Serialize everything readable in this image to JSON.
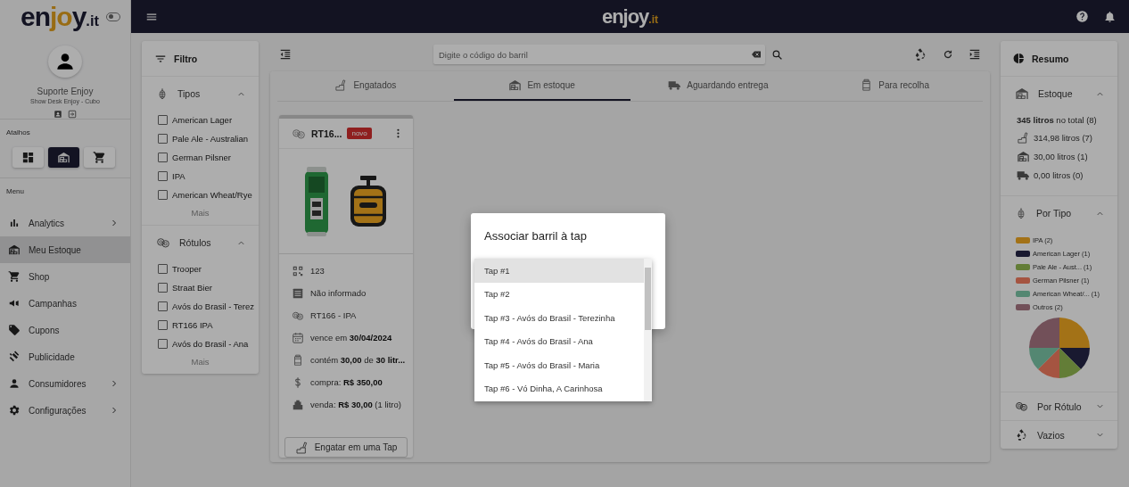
{
  "sidebar": {
    "logo": {
      "text": "enjoy",
      "suffix": ".it"
    },
    "theme_toggle": {
      "on": false
    },
    "user": {
      "name": "Suporte Enjoy",
      "subtitle": "Show Desk Enjoy - Cubo"
    },
    "shortcuts_label": "Atalhos",
    "shortcuts": [
      {
        "selected": false
      },
      {
        "selected": true
      },
      {
        "selected": false
      }
    ],
    "menu_label": "Menu",
    "menu": [
      {
        "label": "Analytics",
        "expandable": true,
        "selected": false
      },
      {
        "label": "Meu Estoque",
        "expandable": false,
        "selected": true
      },
      {
        "label": "Shop",
        "expandable": false,
        "selected": false
      },
      {
        "label": "Campanhas",
        "expandable": false,
        "selected": false
      },
      {
        "label": "Cupons",
        "expandable": false,
        "selected": false
      },
      {
        "label": "Publicidade",
        "expandable": false,
        "selected": false
      },
      {
        "label": "Consumidores",
        "expandable": true,
        "selected": false
      },
      {
        "label": "Configurações",
        "expandable": true,
        "selected": false
      }
    ]
  },
  "top_bar": {
    "logo": {
      "text": "enjoy",
      "suffix": ".it"
    }
  },
  "filter": {
    "title": "Filtro",
    "sections": [
      {
        "title": "Tipos",
        "expanded": true,
        "options": [
          {
            "label": "American Lager",
            "checked": false
          },
          {
            "label": "Pale Ale - Australian",
            "checked": false
          },
          {
            "label": "German Pilsner",
            "checked": false
          },
          {
            "label": "IPA",
            "checked": false
          },
          {
            "label": "American Wheat/Rye",
            "checked": false
          }
        ],
        "more": "Mais"
      },
      {
        "title": "Rótulos",
        "expanded": true,
        "options": [
          {
            "label": "Trooper",
            "checked": false
          },
          {
            "label": "Straat Bier",
            "checked": false
          },
          {
            "label": "Avós do Brasil - Terez",
            "checked": false
          },
          {
            "label": "RT166 IPA",
            "checked": false
          },
          {
            "label": "Avós do Brasil - Ana",
            "checked": false
          }
        ],
        "more": "Mais"
      }
    ]
  },
  "search": {
    "placeholder": "Digite o código do barril"
  },
  "tabs": [
    {
      "label": "Engatados",
      "selected": false
    },
    {
      "label": "Em estoque",
      "selected": true
    },
    {
      "label": "Aguardando entrega",
      "selected": false
    },
    {
      "label": "Para recolha",
      "selected": false
    }
  ],
  "card": {
    "title": "RT16...",
    "badge": "novo",
    "details": [
      "123",
      "Não informado",
      "RT166 - IPA",
      "vence em **30/04/2024**",
      "contém **30,00** de **30 litr...**",
      "compra: **R$ 350,00**",
      "venda: **R$ 30,00** (1 litro)"
    ],
    "button": "Engatar em uma Tap"
  },
  "summary": {
    "title": "Resumo",
    "stock": {
      "title": "Estoque",
      "expanded": true,
      "total": "**345 litros** no total (8)",
      "rows": [
        "314,98 litros (7)",
        "30,00 litros (1)",
        "0,00 litros (0)"
      ]
    },
    "by_type": {
      "title": "Por Tipo",
      "expanded": true,
      "legend": [
        {
          "label": "IPA (2)",
          "color": "#a47317"
        },
        {
          "label": "American Lager (1)",
          "color": "#1a1a30"
        },
        {
          "label": "Pale Ale - Aust... (1)",
          "color": "#647d37"
        },
        {
          "label": "German Pilsner (1)",
          "color": "#a55541"
        },
        {
          "label": "American Wheat/... (1)",
          "color": "#558773"
        },
        {
          "label": "Outros (2)",
          "color": "#73505a"
        }
      ],
      "chart_data": {
        "type": "pie",
        "values": [
          25,
          12.5,
          12.5,
          12.5,
          12.5,
          25
        ]
      }
    },
    "collapsed": [
      {
        "title": "Por Rótulo",
        "expanded": false
      },
      {
        "title": "Vazios",
        "expanded": false
      }
    ]
  },
  "dialog": {
    "title": "Associar barril à tap",
    "options": [
      {
        "label": "Tap #1",
        "selected": true
      },
      {
        "label": "Tap #2",
        "selected": false
      },
      {
        "label": "Tap #3 - Avós do Brasil - Terezinha",
        "selected": false
      },
      {
        "label": "Tap #4 - Avós do Brasil - Ana",
        "selected": false
      },
      {
        "label": "Tap #5 - Avós do Brasil - Maria",
        "selected": false
      },
      {
        "label": "Tap #6 - Vó Dinha, A Carinhosa",
        "selected": false
      }
    ]
  }
}
